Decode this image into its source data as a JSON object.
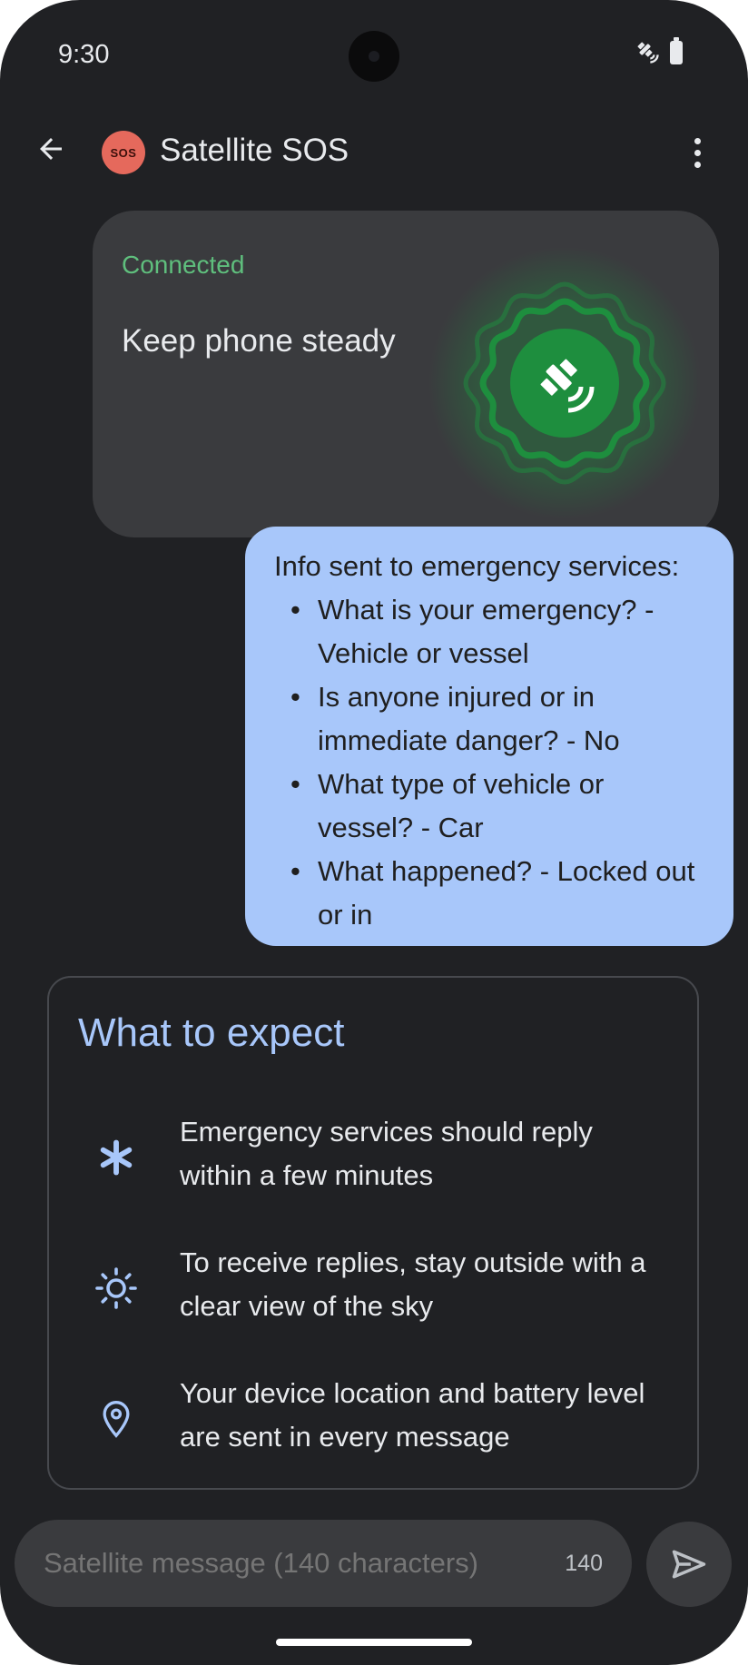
{
  "status_bar": {
    "time": "9:30"
  },
  "app_bar": {
    "avatar_label": "SOS",
    "title": "Satellite SOS"
  },
  "connection": {
    "status": "Connected",
    "message": "Keep phone steady"
  },
  "sent_message": {
    "title": "Info sent to emergency services:",
    "items": [
      "What is your emergency? - Vehicle or vessel",
      "Is anyone injured or in immediate danger? - No",
      "What type of vehicle or vessel? - Car",
      "What happened? - Locked out or in"
    ]
  },
  "expect": {
    "title": "What to expect",
    "items": [
      {
        "icon": "asterisk-icon",
        "text": "Emergency services should reply within a few minutes"
      },
      {
        "icon": "sun-icon",
        "text": "To receive replies, stay outside with a clear view of the sky"
      },
      {
        "icon": "location-pin-icon",
        "text": "Your device location and battery level are sent in every message"
      }
    ]
  },
  "composer": {
    "placeholder": "Satellite message (140 characters)",
    "char_count": "140"
  },
  "colors": {
    "background": "#202124",
    "accent": "#a8c7fa",
    "connected": "#5fbf7d",
    "sos": "#e5695c",
    "satellite_green": "#1e8e3e"
  }
}
